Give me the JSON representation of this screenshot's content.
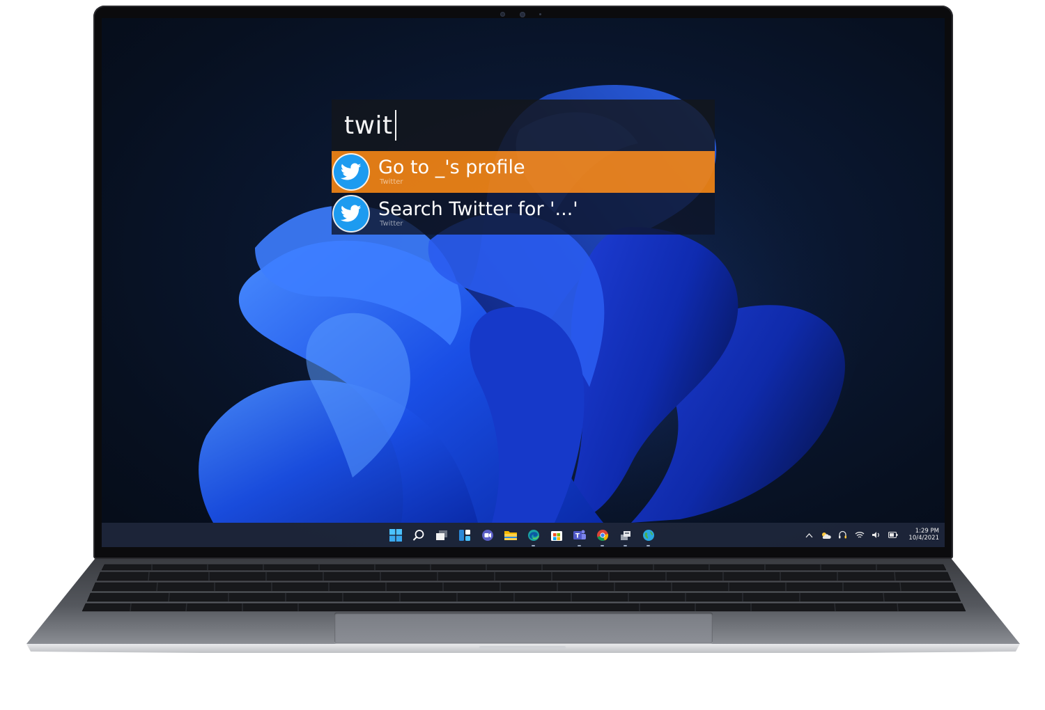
{
  "launcher": {
    "query": "twit",
    "results": [
      {
        "title": "Go to _'s profile",
        "subtitle": "Twitter",
        "icon": "twitter-bird-icon",
        "selected": true
      },
      {
        "title": "Search Twitter for '...'",
        "subtitle": "Twitter",
        "icon": "twitter-bird-icon",
        "selected": false
      }
    ]
  },
  "taskbar": {
    "apps": [
      {
        "name": "start",
        "icon": "windows-start-icon"
      },
      {
        "name": "search",
        "icon": "search-icon"
      },
      {
        "name": "task-view",
        "icon": "task-view-icon"
      },
      {
        "name": "widgets",
        "icon": "widgets-icon"
      },
      {
        "name": "chat",
        "icon": "chat-icon"
      },
      {
        "name": "file-explorer",
        "icon": "folder-icon"
      },
      {
        "name": "edge",
        "icon": "edge-browser-icon"
      },
      {
        "name": "store",
        "icon": "store-icon"
      },
      {
        "name": "teams",
        "icon": "teams-icon"
      },
      {
        "name": "chrome",
        "icon": "chrome-icon"
      },
      {
        "name": "app-1",
        "icon": "app-icon"
      },
      {
        "name": "app-2",
        "icon": "globe-app-icon"
      }
    ],
    "tray": {
      "time": "1:29 PM",
      "date": "10/4/2021"
    }
  },
  "colors": {
    "accent_orange": "#f08314",
    "twitter_blue": "#1d9bf0"
  }
}
